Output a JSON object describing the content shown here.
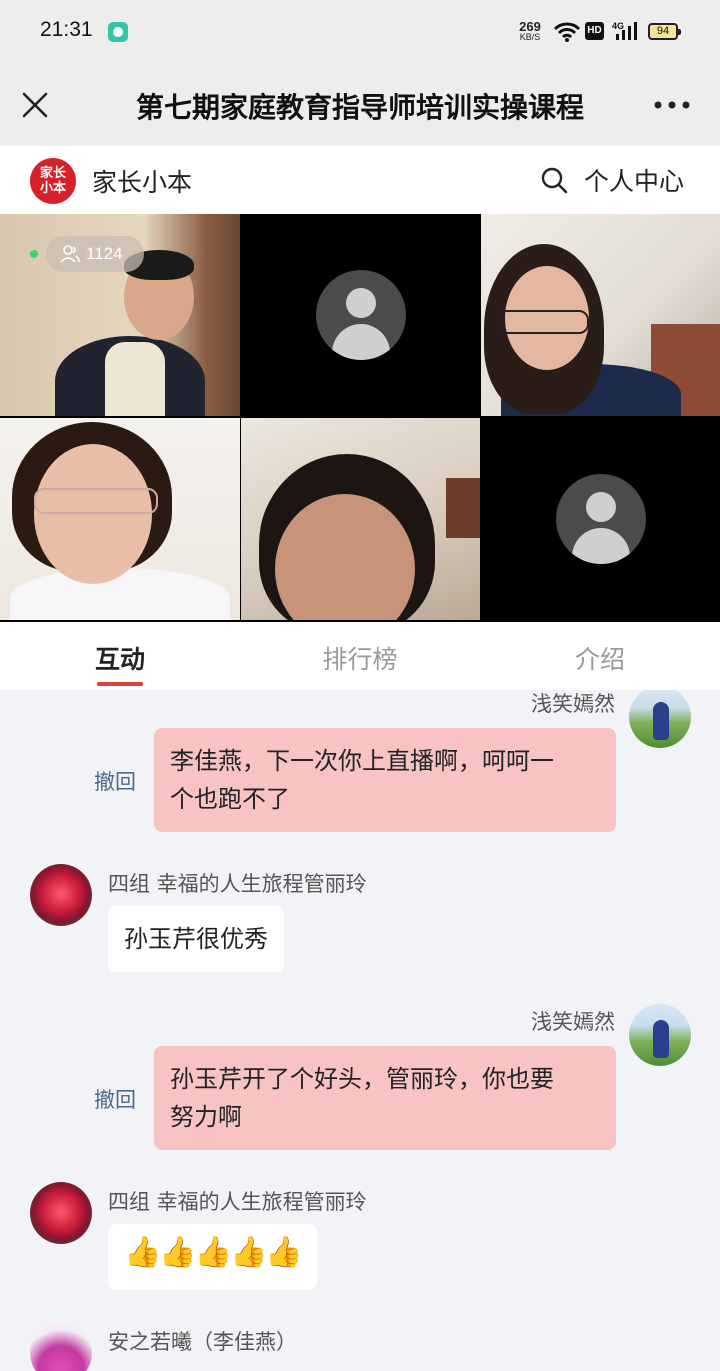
{
  "status_bar": {
    "time": "21:31",
    "net_speed": "269",
    "net_unit": "KB/S",
    "hd_badge": "HD",
    "network": "4G",
    "battery": "94"
  },
  "title_bar": {
    "title": "第七期家庭教育指导师培训实操课程"
  },
  "brand_bar": {
    "logo_text_line1": "家长",
    "logo_text_line2": "小本",
    "brand_name": "家长小本",
    "personal_center": "个人中心"
  },
  "live": {
    "viewer_count": "1124"
  },
  "tabs": [
    {
      "label": "互动",
      "active": true
    },
    {
      "label": "排行榜",
      "active": false
    },
    {
      "label": "介绍",
      "active": false
    }
  ],
  "messages": [
    {
      "sender": "浅笑嫣然",
      "side": "right",
      "recall": "撤回",
      "text_lines": [
        "李佳燕，下一次你上直播啊，呵呵一",
        "个也跑不了"
      ]
    },
    {
      "sender": "四组 幸福的人生旅程管丽玲",
      "side": "left",
      "text": "孙玉芹很优秀"
    },
    {
      "sender": "浅笑嫣然",
      "side": "right",
      "recall": "撤回",
      "text_lines": [
        "孙玉芹开了个好头，管丽玲，你也要",
        "努力啊"
      ]
    },
    {
      "sender": "四组 幸福的人生旅程管丽玲",
      "side": "left",
      "text": "👍👍👍👍👍"
    },
    {
      "sender": "安之若曦（李佳燕）",
      "side": "left"
    }
  ],
  "colors": {
    "accent_red": "#e0403c",
    "pink_bubble": "#f7c3c3",
    "recall_blue": "#4a6a8f"
  }
}
